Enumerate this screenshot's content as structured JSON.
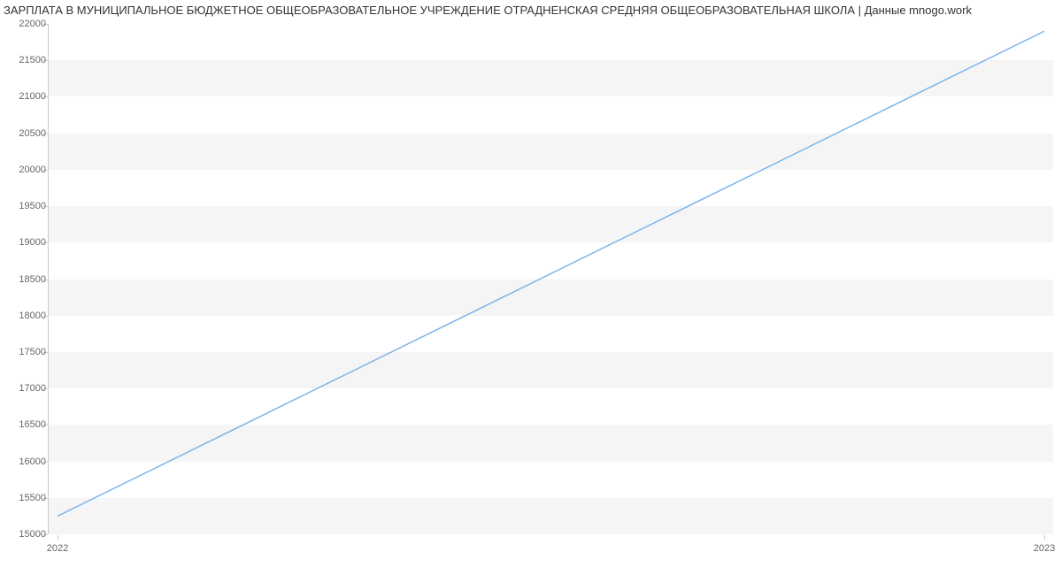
{
  "chart_data": {
    "type": "line",
    "title": "ЗАРПЛАТА В МУНИЦИПАЛЬНОЕ БЮДЖЕТНОЕ ОБЩЕОБРАЗОВАТЕЛЬНОЕ УЧРЕЖДЕНИЕ ОТРАДНЕНСКАЯ СРЕДНЯЯ ОБЩЕОБРАЗОВАТЕЛЬНАЯ ШКОЛА | Данные mnogo.work",
    "categories": [
      "2022",
      "2023"
    ],
    "values": [
      15250,
      21900
    ],
    "xlabel": "",
    "ylabel": "",
    "ylim": [
      15000,
      22000
    ],
    "y_ticks": [
      15000,
      15500,
      16000,
      16500,
      17000,
      17500,
      18000,
      18500,
      19000,
      19500,
      20000,
      20500,
      21000,
      21500,
      22000
    ],
    "line_color": "#7cb5ec"
  }
}
